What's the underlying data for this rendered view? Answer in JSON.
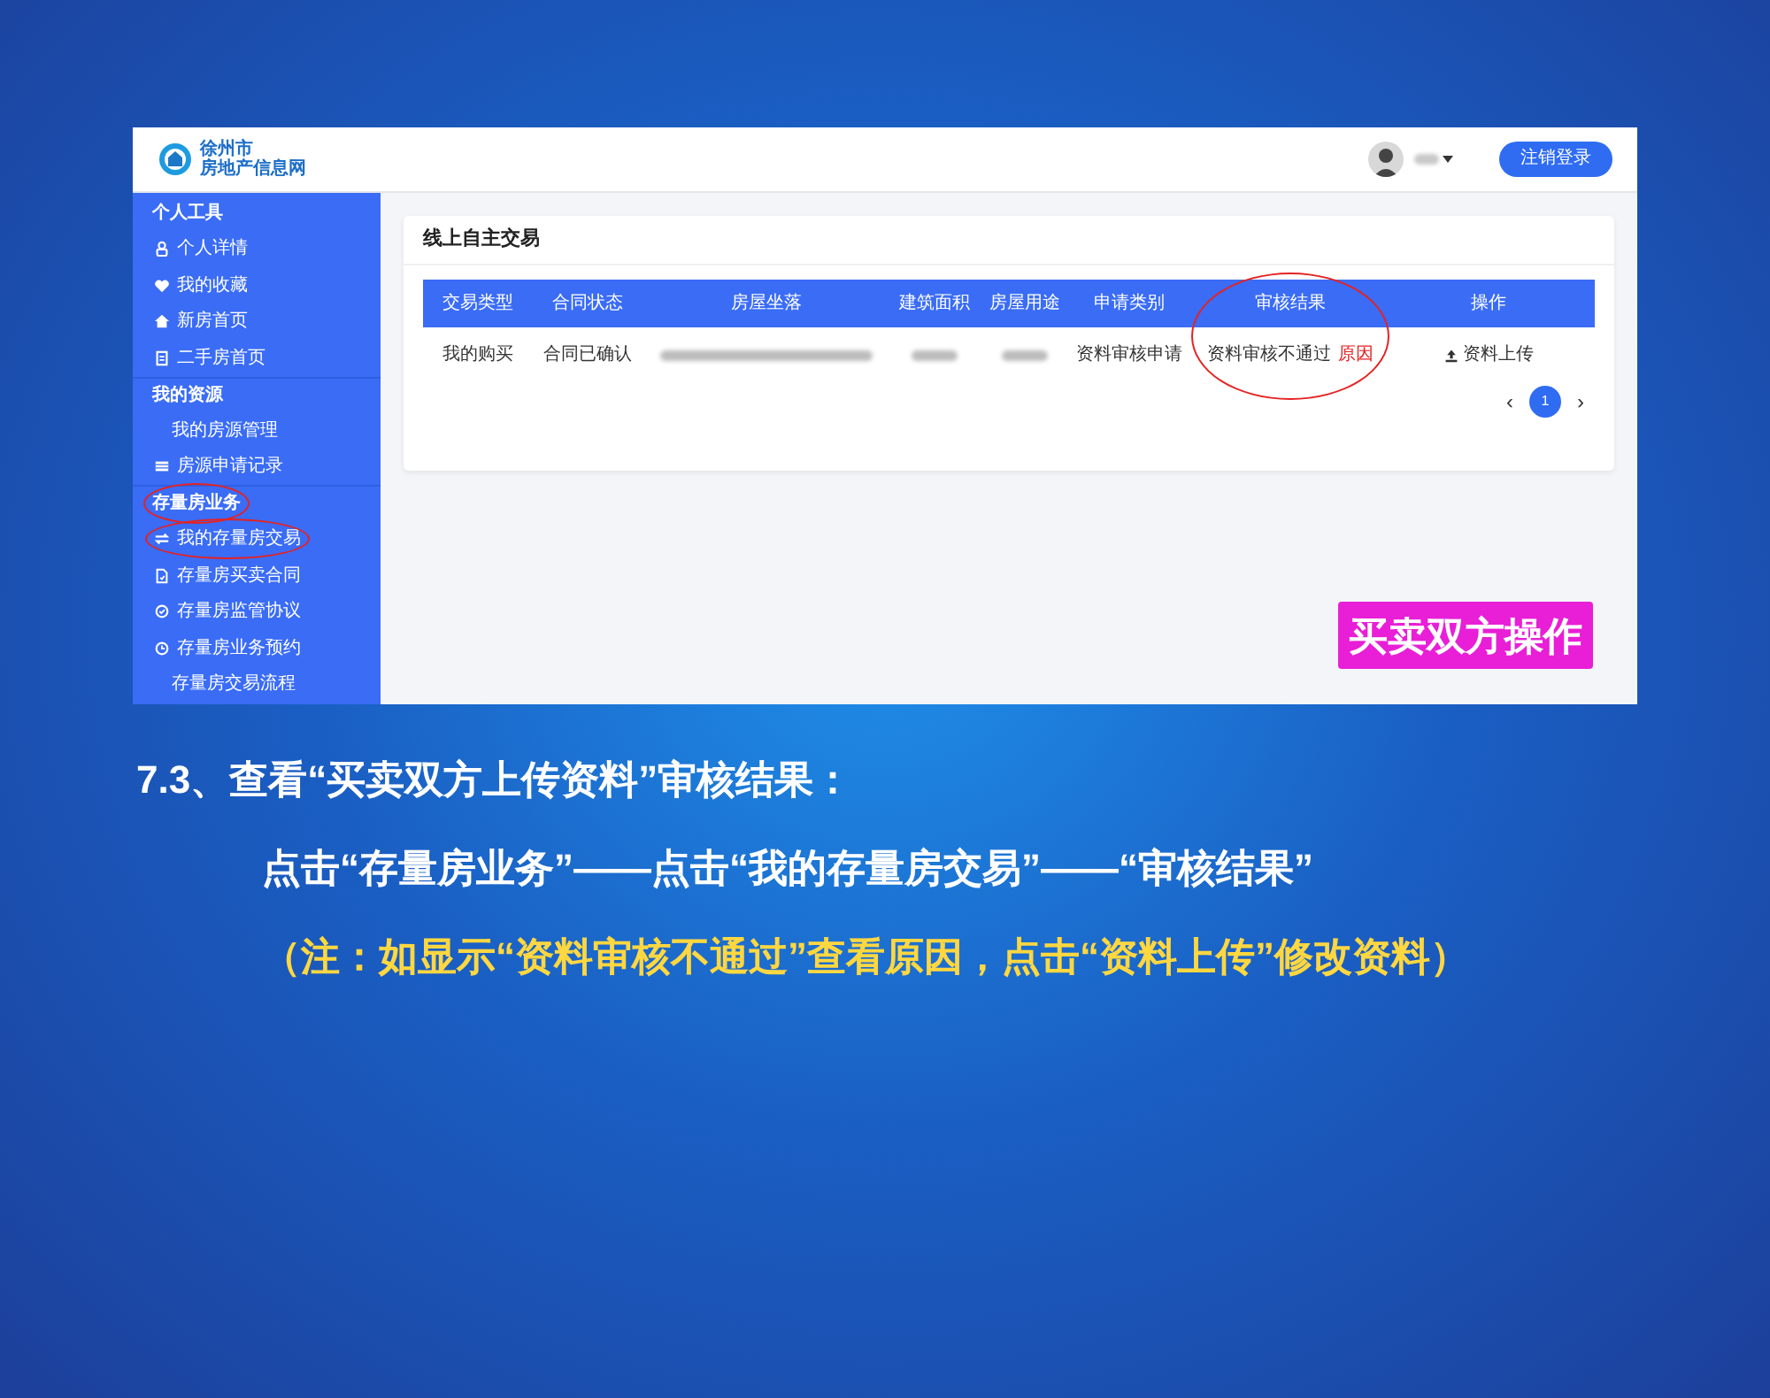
{
  "screenshot": {
    "logo": {
      "line_1": "徐州市",
      "line_2": "房地产信息网"
    },
    "header": {
      "logout_button": "注销登录"
    },
    "sidebar": [
      {
        "title": "个人工具",
        "highlighted": false,
        "items": [
          {
            "label": "个人详情",
            "kind": "icon",
            "highlighted": false
          },
          {
            "label": "我的收藏",
            "kind": "icon",
            "highlighted": false
          },
          {
            "label": "新房首页",
            "kind": "icon",
            "highlighted": false
          },
          {
            "label": "二手房首页",
            "kind": "icon",
            "highlighted": false
          }
        ]
      },
      {
        "title": "我的资源",
        "highlighted": false,
        "items": [
          {
            "label": "我的房源管理",
            "kind": "plain",
            "highlighted": false
          },
          {
            "label": "房源申请记录",
            "kind": "icon",
            "highlighted": false
          }
        ]
      },
      {
        "title": "存量房业务",
        "highlighted": true,
        "items": [
          {
            "label": "我的存量房交易",
            "kind": "icon",
            "highlighted": true
          },
          {
            "label": "存量房买卖合同",
            "kind": "icon",
            "highlighted": false
          },
          {
            "label": "存量房监管协议",
            "kind": "icon",
            "highlighted": false
          },
          {
            "label": "存量房业务预约",
            "kind": "icon",
            "highlighted": false
          },
          {
            "label": "存量房交易流程",
            "kind": "plain",
            "highlighted": false
          }
        ]
      }
    ],
    "card": {
      "title": "线上自主交易",
      "table": {
        "columns": [
          {
            "label": "交易类型",
            "highlighted": false
          },
          {
            "label": "合同状态",
            "highlighted": false
          },
          {
            "label": "房屋坐落",
            "highlighted": false
          },
          {
            "label": "建筑面积",
            "highlighted": false
          },
          {
            "label": "房屋用途",
            "highlighted": false
          },
          {
            "label": "申请类别",
            "highlighted": false
          },
          {
            "label": "审核结果",
            "highlighted": true
          },
          {
            "label": "操作",
            "highlighted": false
          }
        ],
        "rows": [
          [
            {
              "kind": "text",
              "text": "我的购买"
            },
            {
              "kind": "text",
              "text": "合同已确认"
            },
            {
              "kind": "blurred"
            },
            {
              "kind": "blurred"
            },
            {
              "kind": "blurred"
            },
            {
              "kind": "text",
              "text": "资料审核申请"
            },
            {
              "kind": "status",
              "text": "资料审核不通过",
              "link": "原因"
            },
            {
              "kind": "action",
              "text": "资料上传"
            }
          ]
        ]
      },
      "pagination": {
        "prev": "‹",
        "pages": [
          {
            "label": "1",
            "selected": true
          }
        ],
        "next": "›"
      }
    },
    "badge": "买卖双方操作"
  },
  "heading": "7.3、查看“买卖双方上传资料”审核结果：",
  "steps": "点击“存量房业务”——点击“我的存量房交易”——“审核结果”",
  "note": "（注：如显示“资料审核不通过”查看原因，点击“资料上传”修改资料）"
}
